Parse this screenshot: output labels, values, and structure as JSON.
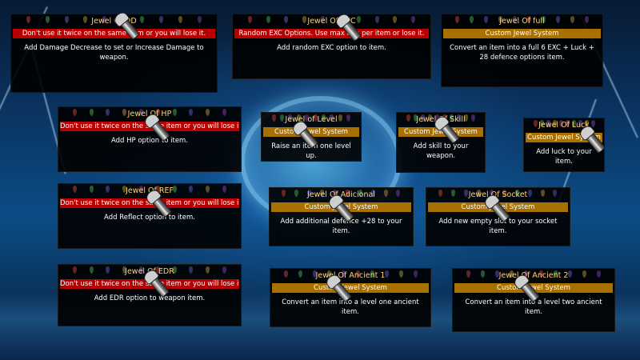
{
  "items": [
    {
      "id": "dd",
      "title": "Jewel Of DD",
      "warning": "Don't use it twice on the same item or you will lose it.",
      "system": "",
      "desc": "Add Damage Decrease to set or Increase Damage to weapon."
    },
    {
      "id": "exc",
      "title": "Jewel Of EXC",
      "warning": "Random EXC Options. Use max one per item or lose it.",
      "system": "",
      "desc": "Add random EXC option to item."
    },
    {
      "id": "full",
      "title": "Jewel Of full",
      "warning": "",
      "system": "Custom Jewel System",
      "desc": "Convert an item into a full 6 EXC + Luck + 28 defence options item."
    },
    {
      "id": "hp",
      "title": "Jewel Of HP",
      "warning": "Don't use it twice on the same item or you will lose it.",
      "system": "",
      "desc": "Add HP option to item."
    },
    {
      "id": "level",
      "title": "Jewel of Level",
      "warning": "",
      "system": "Custom Jewel System",
      "desc": "Raise an item one level up."
    },
    {
      "id": "skill",
      "title": "Jewel Of Skill",
      "warning": "",
      "system": "Custom Jewel System",
      "desc": "Add skill to your weapon."
    },
    {
      "id": "luck",
      "title": "Jewel Of Luck",
      "warning": "",
      "system": "Custom Jewel System",
      "desc": "Add luck to your item."
    },
    {
      "id": "ref",
      "title": "Jewel Of REF",
      "warning": "Don't use it twice on the same item or you will lose it.",
      "system": "",
      "desc": "Add Reflect option to item."
    },
    {
      "id": "adicional",
      "title": "Jewel Of Adicional",
      "warning": "",
      "system": "Custom Jewel System",
      "desc": "Add additional defence +28 to your item."
    },
    {
      "id": "socket",
      "title": "Jewel Of Socket",
      "warning": "",
      "system": "Custom Jewel System",
      "desc": "Add new empty slot to your socket item."
    },
    {
      "id": "edr",
      "title": "Jewel Of EDR",
      "warning": "Don't use it twice on the same item or you will lose it.",
      "system": "",
      "desc": "Add EDR option to weapon item."
    },
    {
      "id": "ancient1",
      "title": "Jewel Of Ancient 1",
      "warning": "",
      "system": "Custom Jewel System",
      "desc": "Convert an item into a level one ancient item."
    },
    {
      "id": "ancient2",
      "title": "Jewel Of Ancient 2",
      "warning": "",
      "system": "Custom Jewel System",
      "desc": "Convert an item into a level two ancient item."
    }
  ],
  "colors": {
    "title": "#ffd27a",
    "warning_bg": "#b80000",
    "system_bg": "#a77000",
    "gems": [
      "#7a2a2a",
      "#2a6a3a",
      "#3a3a7a",
      "#6a5a2a",
      "#4a2a6a"
    ]
  },
  "icons": {
    "cursor": "wrench-cursor-icon",
    "gem": "gem-socket-icon"
  }
}
